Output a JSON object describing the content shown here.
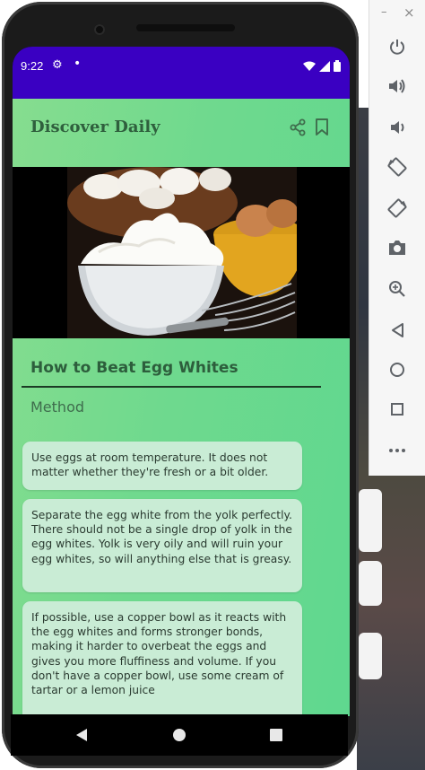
{
  "status_bar": {
    "time": "9:22"
  },
  "app": {
    "title": "Discover Daily",
    "article_title": "How to Beat Egg Whites",
    "section_title": "Method",
    "steps": [
      "Use eggs at room temperature. It does not matter whether they're fresh or a bit older.",
      "Separate the egg white from the yolk perfectly. There should not be a single drop of yolk in the egg whites. Yolk is very oily and will ruin your egg whites, so will anything else that is greasy.",
      "If possible, use a copper bowl as it reacts with the egg whites and forms stronger bonds, making it harder to overbeat the eggs and gives you more fluffiness and volume. If you don't have a copper bowl, use some cream of tartar or a lemon juice"
    ]
  },
  "icons": {
    "share": "share-icon",
    "bookmark": "bookmark-icon",
    "settings": "gear-icon",
    "wifi": "wifi-icon",
    "signal": "signal-icon",
    "battery": "battery-icon"
  },
  "emulator_panel": {
    "minimize": "–",
    "close": "×",
    "buttons": [
      "power-icon",
      "volume-up-icon",
      "volume-down-icon",
      "rotate-left-icon",
      "rotate-right-icon",
      "camera-icon",
      "zoom-icon",
      "back-icon",
      "home-icon",
      "overview-icon",
      "more-icon"
    ]
  },
  "colors": {
    "status_bar": "#3a00c2",
    "app_gradient_start": "#86dd8f",
    "app_gradient_end": "#5fd88f",
    "card": "#c9ecd5",
    "title_text": "#2f5f3d"
  }
}
